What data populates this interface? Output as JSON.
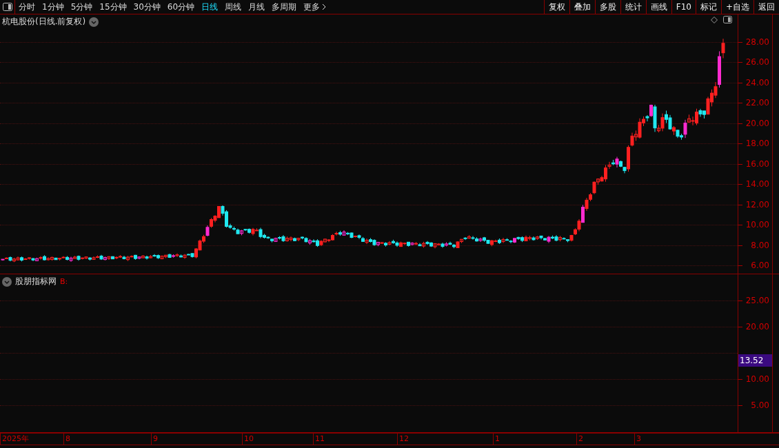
{
  "toolbar": {
    "periods": [
      {
        "label": "分时",
        "selected": false
      },
      {
        "label": "1分钟",
        "selected": false
      },
      {
        "label": "5分钟",
        "selected": false
      },
      {
        "label": "15分钟",
        "selected": false
      },
      {
        "label": "30分钟",
        "selected": false
      },
      {
        "label": "60分钟",
        "selected": false
      },
      {
        "label": "日线",
        "selected": true
      },
      {
        "label": "周线",
        "selected": false
      },
      {
        "label": "月线",
        "selected": false
      },
      {
        "label": "多周期",
        "selected": false
      }
    ],
    "more": "更多",
    "actions": [
      "复权",
      "叠加",
      "多股",
      "统计",
      "画线",
      "F10",
      "标记",
      "+自选",
      "返回"
    ]
  },
  "main_chart": {
    "title": "杭电股份(日线.前复权)",
    "y_labels": [
      "28.00",
      "26.00",
      "24.00",
      "22.00",
      "20.00",
      "18.00",
      "16.00",
      "14.00",
      "12.00",
      "10.00",
      "8.00",
      "6.00"
    ]
  },
  "indicator": {
    "name": "股朋指标网",
    "label": "B:",
    "y_labels": [
      "25.00",
      "20.00",
      "10.00",
      "5.00"
    ],
    "marker": "13.52"
  },
  "time_axis": [
    "2025年",
    "8",
    "9",
    "10",
    "11",
    "12",
    "1",
    "2",
    "3"
  ]
}
